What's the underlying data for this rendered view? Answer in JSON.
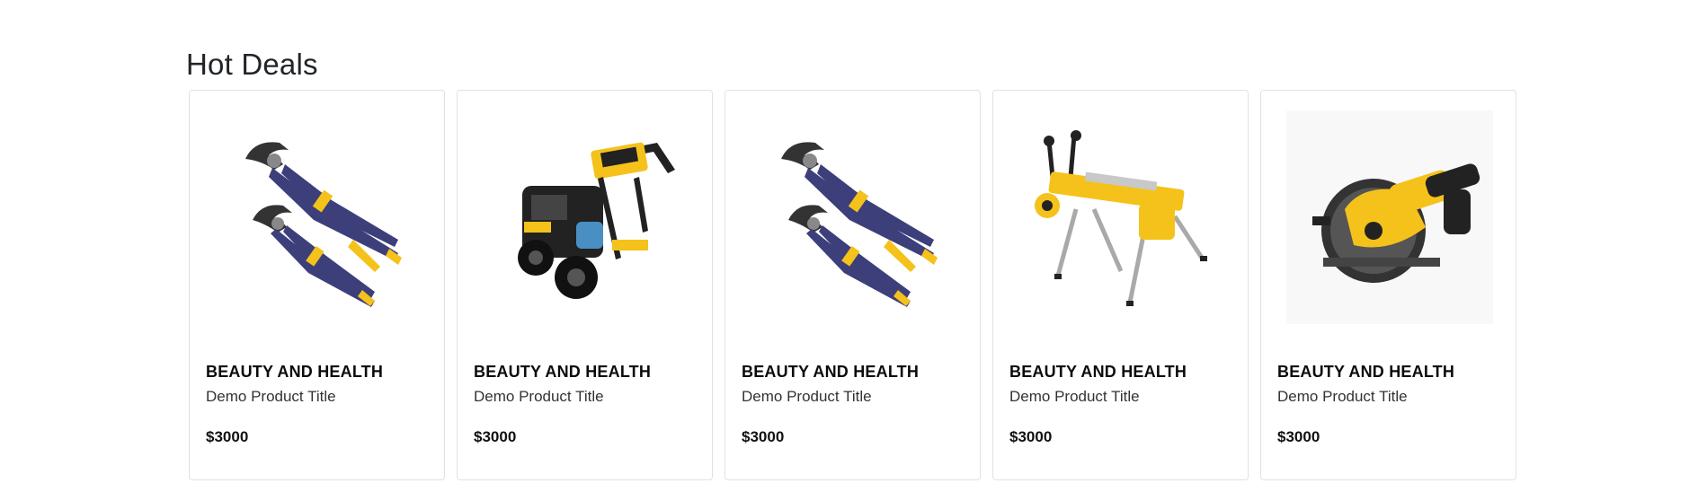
{
  "section": {
    "title": "Hot Deals"
  },
  "products": [
    {
      "category": "BEAUTY AND HEALTH",
      "title": "Demo Product Title",
      "price": "$3000",
      "image": "pliers-icon"
    },
    {
      "category": "BEAUTY AND HEALTH",
      "title": "Demo Product Title",
      "price": "$3000",
      "image": "pressure-washer-icon"
    },
    {
      "category": "BEAUTY AND HEALTH",
      "title": "Demo Product Title",
      "price": "$3000",
      "image": "pliers-icon"
    },
    {
      "category": "BEAUTY AND HEALTH",
      "title": "Demo Product Title",
      "price": "$3000",
      "image": "saw-stand-icon"
    },
    {
      "category": "BEAUTY AND HEALTH",
      "title": "Demo Product Title",
      "price": "$3000",
      "image": "circular-saw-icon"
    }
  ],
  "colors": {
    "tool_yellow": "#f4c21a",
    "tool_black": "#222222",
    "handle_blue": "#3c3f7a",
    "metal_gray": "#a9a9a9",
    "card_border": "#dee2e6"
  }
}
